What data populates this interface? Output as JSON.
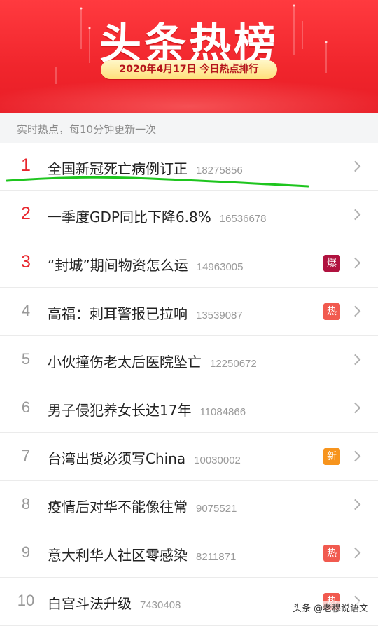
{
  "banner": {
    "title": "头条热榜",
    "date_label": "2020年4月17日 今日热点排行"
  },
  "subheader": {
    "text": "实时热点，每10分钟更新一次"
  },
  "items": [
    {
      "rank": "1",
      "title": "全国新冠死亡病例订正",
      "count": "18275856",
      "badge": ""
    },
    {
      "rank": "2",
      "title": "一季度GDP同比下降6.8%",
      "count": "16536678",
      "badge": ""
    },
    {
      "rank": "3",
      "title": "“封城”期间物资怎么运",
      "count": "14963005",
      "badge": "爆"
    },
    {
      "rank": "4",
      "title": "高福：刺耳警报已拉响",
      "count": "13539087",
      "badge": "热"
    },
    {
      "rank": "5",
      "title": "小伙撞伤老太后医院坠亡",
      "count": "12250672",
      "badge": ""
    },
    {
      "rank": "6",
      "title": "男子侵犯养女长达17年",
      "count": "11084866",
      "badge": ""
    },
    {
      "rank": "7",
      "title": "台湾出货必须写China",
      "count": "10030002",
      "badge": "新"
    },
    {
      "rank": "8",
      "title": "疫情后对华不能像往常",
      "count": "9075521",
      "badge": ""
    },
    {
      "rank": "9",
      "title": "意大利华人社区零感染",
      "count": "8211871",
      "badge": "热"
    },
    {
      "rank": "10",
      "title": "白宫斗法升级",
      "count": "7430408",
      "badge": "热"
    }
  ],
  "badge_colors": {
    "爆": "#b0123f",
    "热": "#f15a4f",
    "新": "#f7941d"
  },
  "accent": "#e8262d",
  "annotation_color": "#1ec51e",
  "watermark": "头条 @老穆说语文"
}
